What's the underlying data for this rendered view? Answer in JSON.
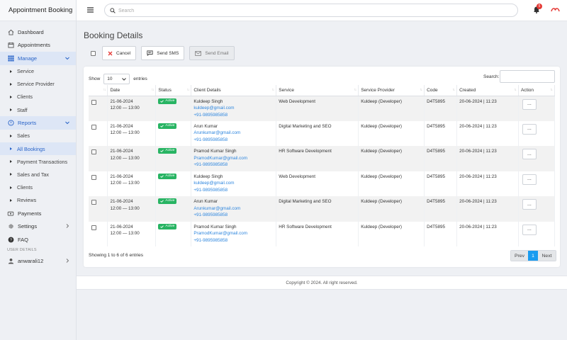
{
  "brand": "Appointment Booking",
  "header": {
    "search_placeholder": "Search",
    "notification_count": "5"
  },
  "sidebar": {
    "dashboard": "Dashboard",
    "appointments": "Appointments",
    "manage": "Manage",
    "manage_items": [
      "Service",
      "Service Provider",
      "Clients",
      "Staff"
    ],
    "reports": "Reports",
    "reports_items": [
      "Sales",
      "All Bookings",
      "Payment Transactions",
      "Sales and Tax",
      "Clients",
      "Reviews"
    ],
    "payments": "Payments",
    "settings": "Settings",
    "faq": "FAQ",
    "user_details_label": "USER DETAILS",
    "username": "anwarali12"
  },
  "page": {
    "title": "Booking Details"
  },
  "toolbar": {
    "cancel": "Cancel",
    "send_sms": "Send SMS",
    "send_email": "Send Email"
  },
  "table_controls": {
    "show_label": "Show",
    "page_size": "10",
    "entries_label": "entries",
    "search_label": "Search:"
  },
  "columns": [
    "Date",
    "Status",
    "Client Details",
    "Service",
    "Service Provider",
    "Code",
    "Created",
    "Action"
  ],
  "rows": [
    {
      "date": "21-06-2024",
      "time": "12:00 — 13:00",
      "status": "Active",
      "client_name": "Kuldeep Singh",
      "client_email": "kuldeep@gmail.com",
      "client_phone": "+91-9895985858",
      "service": "Web Development",
      "provider": "Kuldeep (Developer)",
      "code": "D4T5895",
      "created": "20-06-2024 | 11:23",
      "action": "..."
    },
    {
      "date": "21-06-2024",
      "time": "12:00 — 13:00",
      "status": "Active",
      "client_name": "Arun Kumar",
      "client_email": "Arunkumar@gmail.com",
      "client_phone": "+91-9895985858",
      "service": "Digital Marketing and SEO",
      "provider": "Kuldeep (Developer)",
      "code": "D4T5895",
      "created": "20-06-2024 | 11:23",
      "action": "..."
    },
    {
      "date": "21-06-2024",
      "time": "12:00 — 13:00",
      "status": "Active",
      "client_name": "Pramod Kumar Singh",
      "client_email": "PramodKumar@gmail.com",
      "client_phone": "+91-9895985858",
      "service": "HR Software Development",
      "provider": "Kuldeep (Developer)",
      "code": "D4T5895",
      "created": "20-06-2024 | 11:23",
      "action": "..."
    },
    {
      "date": "21-06-2024",
      "time": "12:00 — 13:00",
      "status": "Active",
      "client_name": "Kuldeep Singh",
      "client_email": "kuldeep@gmail.com",
      "client_phone": "+91-9895985858",
      "service": "Web Development",
      "provider": "Kuldeep (Developer)",
      "code": "D4T5895",
      "created": "20-06-2024 | 11:23",
      "action": "..."
    },
    {
      "date": "21-06-2024",
      "time": "12:00 — 13:00",
      "status": "Active",
      "client_name": "Arun Kumar",
      "client_email": "Arunkumar@gmail.com",
      "client_phone": "+91-9895985858",
      "service": "Digital Marketing and SEO",
      "provider": "Kuldeep (Developer)",
      "code": "D4T5895",
      "created": "20-06-2024 | 11:23",
      "action": "..."
    },
    {
      "date": "21-06-2024",
      "time": "12:00 — 13:00",
      "status": "Active",
      "client_name": "Pramod Kumar Singh",
      "client_email": "PramodKumar@gmail.com",
      "client_phone": "+91-9895985858",
      "service": "HR Software Development",
      "provider": "Kuldeep (Developer)",
      "code": "D4T5895",
      "created": "20-06-2024 | 11:23",
      "action": "..."
    }
  ],
  "showing_text": "Showing 1 to 6 of 6 entries",
  "pagination": {
    "prev": "Prev",
    "current": "1",
    "next": "Next"
  },
  "footer": "Copyright © 2024. All right reserved.",
  "colors": {
    "accent": "#2a64c8",
    "active_badge": "#28b463",
    "page_button": "#1a9cf0",
    "notification": "#e53935",
    "link": "#2e86de"
  }
}
